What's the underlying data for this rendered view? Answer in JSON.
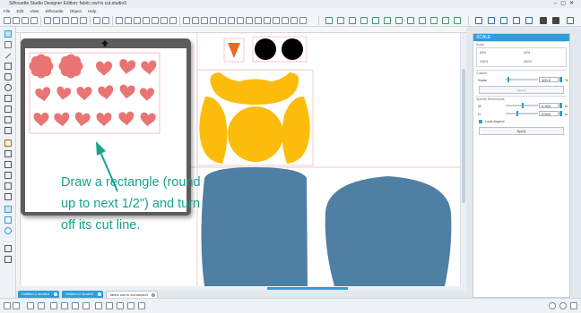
{
  "window": {
    "title": "Silhouette Studio Designer Edition: fabric owl to cut.studio3"
  },
  "menu": [
    "File",
    "Edit",
    "View",
    "Silhouette",
    "Object",
    "Help"
  ],
  "panel": {
    "title": "SCALE",
    "sections": {
      "scale": "Scale",
      "custom": "Custom",
      "specify": "Specify Dimensions"
    },
    "presets": [
      "50%",
      "25%",
      "200%",
      "300%"
    ],
    "scale_label": "Scale",
    "scale_value": "100.0",
    "scale_unit": "%",
    "width_label": "W",
    "width_value": "9.300",
    "height_label": "H",
    "height_value": "5.500",
    "dim_unit": "in",
    "apply_small": "Apply",
    "lock_aspect": "Lock Aspect",
    "apply": "Apply",
    "accent": "#2d9ed8"
  },
  "tabs": [
    {
      "label": "Untitled-1.studio3"
    },
    {
      "label": "Untitled-2.studio3"
    },
    {
      "label": "fabric owl to cut.studio3"
    }
  ],
  "annotation": "Draw a rectangle (round up to next 1/2\") and turn off its cut line.",
  "colors": {
    "heart": "#e87574",
    "owl_body": "#fbbc0c",
    "beak": "#f26522",
    "eyes": "#000000",
    "fabric": "#4f7fa3",
    "annotation": "#17a38c"
  }
}
